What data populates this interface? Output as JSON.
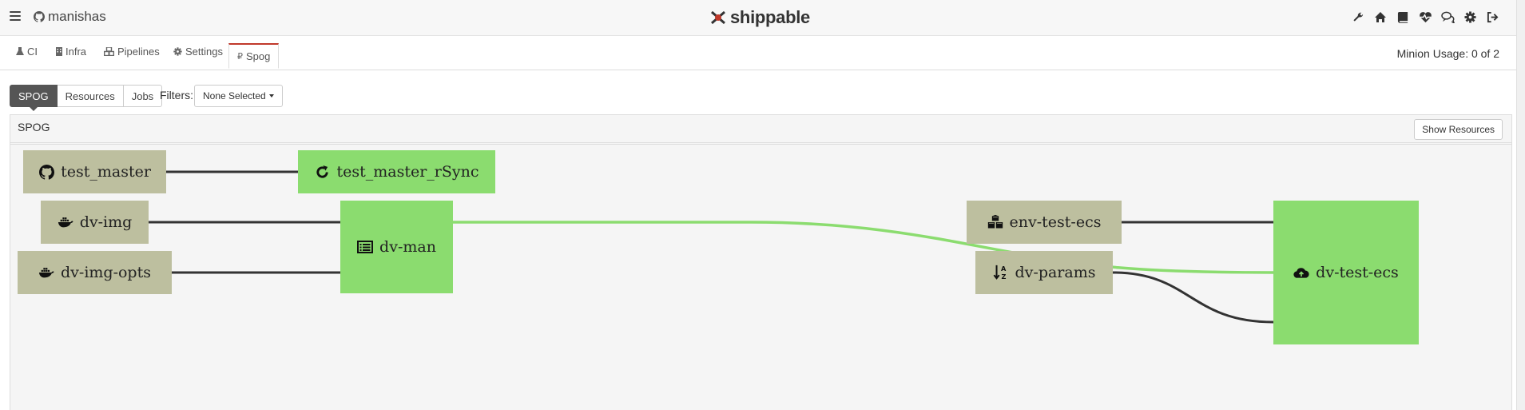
{
  "topbar": {
    "account": "manishas",
    "logo": "shippable",
    "icons": [
      "wrench-icon",
      "home-icon",
      "book-icon",
      "heartbeat-icon",
      "chat-icon",
      "gear-icon",
      "sign-out-icon"
    ]
  },
  "nav": {
    "tabs": [
      {
        "label": "CI",
        "icon": "flask-icon"
      },
      {
        "label": "Infra",
        "icon": "building-icon"
      },
      {
        "label": "Pipelines",
        "icon": "cubes-icon"
      },
      {
        "label": "Settings",
        "icon": "gear-icon"
      },
      {
        "label": "Spog",
        "icon": "paragraph-icon",
        "active": true
      }
    ],
    "minion_usage": "Minion Usage: 0 of 2"
  },
  "toolbar": {
    "views": [
      "SPOG",
      "Resources",
      "Jobs"
    ],
    "active_view": "SPOG",
    "filters_label": "Filters:",
    "filters_value": "None Selected"
  },
  "panel": {
    "title": "SPOG",
    "show_resources": "Show Resources"
  },
  "nodes": [
    {
      "id": "test_master",
      "label": "test_master",
      "kind": "resource",
      "icon": "github-icon"
    },
    {
      "id": "test_master_rSync",
      "label": "test_master_rSync",
      "kind": "job",
      "icon": "refresh-icon"
    },
    {
      "id": "dv-img",
      "label": "dv-img",
      "kind": "resource",
      "icon": "docker-icon"
    },
    {
      "id": "dv-img-opts",
      "label": "dv-img-opts",
      "kind": "resource",
      "icon": "docker-icon"
    },
    {
      "id": "dv-man",
      "label": "dv-man",
      "kind": "job",
      "icon": "manifest-icon"
    },
    {
      "id": "env-test-ecs",
      "label": "env-test-ecs",
      "kind": "resource",
      "icon": "cubes-icon"
    },
    {
      "id": "dv-params",
      "label": "dv-params",
      "kind": "resource",
      "icon": "sort-alpha-icon"
    },
    {
      "id": "dv-test-ecs",
      "label": "dv-test-ecs",
      "kind": "job",
      "icon": "cloud-upload-icon"
    }
  ],
  "edges": [
    {
      "from": "test_master",
      "to": "test_master_rSync",
      "color": "#333333"
    },
    {
      "from": "dv-img",
      "to": "dv-man",
      "color": "#333333"
    },
    {
      "from": "dv-img-opts",
      "to": "dv-man",
      "color": "#333333"
    },
    {
      "from": "dv-man",
      "to": "dv-test-ecs",
      "color": "#8bdc6f"
    },
    {
      "from": "env-test-ecs",
      "to": "dv-test-ecs",
      "color": "#333333"
    },
    {
      "from": "dv-params",
      "to": "dv-test-ecs",
      "color": "#333333"
    }
  ],
  "colors": {
    "resource": "#bdbf9f",
    "job": "#8bdc6f",
    "active_tab": "#c0392b"
  }
}
